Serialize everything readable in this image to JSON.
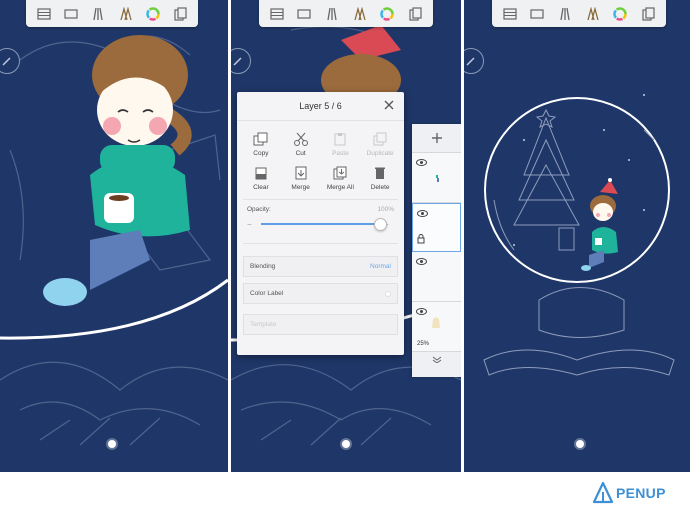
{
  "toolbar_icons": [
    "layers-icon",
    "canvas-icon",
    "pencil-brush-icon",
    "brush-set-icon",
    "color-wheel-icon",
    "clipboard-icon"
  ],
  "layer_dialog": {
    "title": "Layer  5 / 6",
    "operations": [
      {
        "label": "Copy",
        "icon": "copy-icon",
        "enabled": true
      },
      {
        "label": "Cut",
        "icon": "scissors-icon",
        "enabled": true
      },
      {
        "label": "Paste",
        "icon": "paste-icon",
        "enabled": false
      },
      {
        "label": "Duplicate",
        "icon": "duplicate-icon",
        "enabled": false
      },
      {
        "label": "Clear",
        "icon": "clear-icon",
        "enabled": true
      },
      {
        "label": "Merge",
        "icon": "merge-icon",
        "enabled": true
      },
      {
        "label": "Merge All",
        "icon": "merge-all-icon",
        "enabled": true
      },
      {
        "label": "Delete",
        "icon": "trash-icon",
        "enabled": true
      }
    ],
    "opacity_label": "Opacity:",
    "opacity_value": "100%",
    "opacity_fraction": 1.0,
    "blending_label": "Blending",
    "blending_value": "Normal",
    "color_label": "Color Label",
    "template_label": "Template"
  },
  "layer_list": {
    "add_icon": "plus-icon",
    "items": [
      {
        "visible": true,
        "selected": false,
        "opacity_text": ""
      },
      {
        "visible": true,
        "selected": true,
        "opacity_text": ""
      },
      {
        "visible": true,
        "selected": false,
        "opacity_text": ""
      },
      {
        "visible": true,
        "selected": false,
        "opacity_text": "25%"
      }
    ]
  },
  "brand": {
    "name": "PENUP",
    "color": "#3d8fd6"
  },
  "colors": {
    "canvas_bg": "#1f3768",
    "accent": "#5f9fe6"
  }
}
